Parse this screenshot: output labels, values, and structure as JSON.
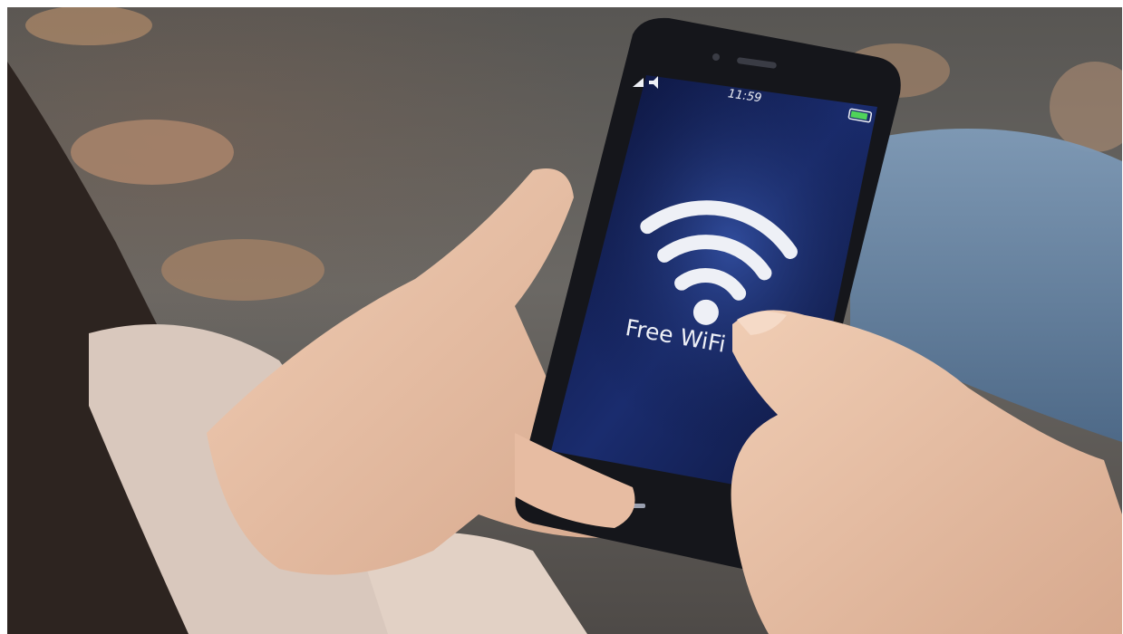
{
  "scene": {
    "phone": {
      "status_time": "11:59",
      "wifi_label": "Free WiFi",
      "screen_color": "#0f1a4a",
      "icon_color": "#eef0f6"
    },
    "icons": [
      "signal-icon",
      "sound-icon",
      "battery-icon",
      "wifi-icon"
    ]
  }
}
